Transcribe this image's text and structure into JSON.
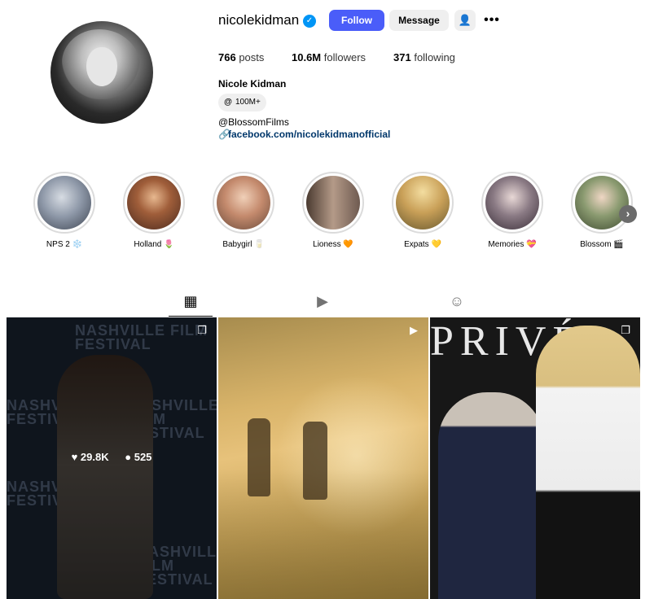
{
  "profile": {
    "username": "nicolekidman",
    "verified_icon": "verified-badge-icon",
    "full_name": "Nicole Kidman",
    "threads_badge": "100M+",
    "bio_mention": "@BlossomFilms",
    "link": "facebook.com/nicolekidmanofficial"
  },
  "actions": {
    "follow": "Follow",
    "message": "Message",
    "add_user_icon": "add-user-icon",
    "more_icon": "more-options-icon"
  },
  "stats": {
    "posts_count": "766",
    "posts_label": "posts",
    "followers_count": "10.6M",
    "followers_label": "followers",
    "following_count": "371",
    "following_label": "following"
  },
  "highlights": [
    {
      "label": "NPS 2 ❄️",
      "color": "#8a96a6"
    },
    {
      "label": "Holland 🌷",
      "color": "#7a4a36"
    },
    {
      "label": "Babygirl 🥛",
      "color": "#c58b73"
    },
    {
      "label": "Lioness 🧡",
      "color": "#8a6a5a"
    },
    {
      "label": "Expats 💛",
      "color": "#c29a58"
    },
    {
      "label": "Memories 💝",
      "color": "#6f5e6c"
    },
    {
      "label": "Blossom 🎬",
      "color": "#6e7a5a"
    }
  ],
  "tabs": [
    {
      "name": "posts-tab",
      "icon": "grid-icon",
      "active": true
    },
    {
      "name": "reels-tab",
      "icon": "reels-icon",
      "active": false
    },
    {
      "name": "tagged-tab",
      "icon": "tagged-icon",
      "active": false
    }
  ],
  "posts": [
    {
      "likes": "29.8K",
      "comments": "525",
      "type": "carousel",
      "backdrop_text": "NASHVILLE FILM FESTIVAL"
    },
    {
      "type": "reel"
    },
    {
      "type": "carousel",
      "backdrop_text": "PRIVÉ"
    }
  ],
  "colors": {
    "follow_button": "#4a5df9",
    "link": "#00376b",
    "verified": "#0095f6"
  }
}
